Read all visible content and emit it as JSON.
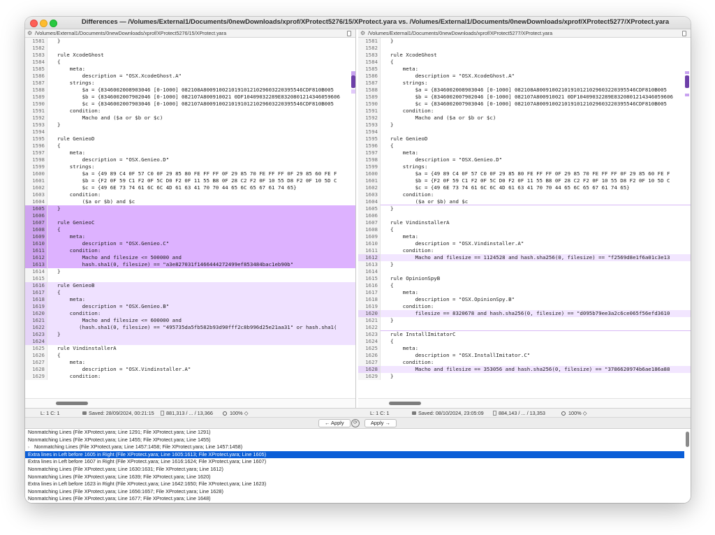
{
  "window": {
    "title": "Differences — /Volumes/External1/Documents/0newDownloads/xprof/XProtect5276/15/XProtect.yara vs. /Volumes/External1/Documents/0newDownloads/xprof/XProtect5277/XProtect.yara"
  },
  "left": {
    "path": "/Volumes/External1/Documents/0newDownloads/xprof/XProtect5276/15/XProtect.yara",
    "lines": [
      {
        "n": "1581",
        "t": "}",
        "h": ""
      },
      {
        "n": "1582",
        "t": "",
        "h": ""
      },
      {
        "n": "1583",
        "t": "rule XcodeGhost",
        "h": ""
      },
      {
        "n": "1584",
        "t": "{",
        "h": ""
      },
      {
        "n": "1585",
        "t": "    meta:",
        "h": ""
      },
      {
        "n": "1586",
        "t": "        description = \"OSX.XcodeGhost.A\"",
        "h": ""
      },
      {
        "n": "1587",
        "t": "    strings:",
        "h": ""
      },
      {
        "n": "1588",
        "t": "        $a = {8346002008903046 [0-1000] 082108A80091002101910121029603220395546CDF810B005",
        "h": ""
      },
      {
        "n": "1589",
        "t": "        $b = {8346002007902046 [0-1000] 082107A800910021 0DF10409032289E8320801214346059606",
        "h": ""
      },
      {
        "n": "1590",
        "t": "        $c = {8346002007903046 [0-1000] 082107A80091002101910121029603220395546CDF810B005",
        "h": ""
      },
      {
        "n": "1591",
        "t": "    condition:",
        "h": ""
      },
      {
        "n": "1592",
        "t": "        Macho and ($a or $b or $c)",
        "h": ""
      },
      {
        "n": "1593",
        "t": "}",
        "h": ""
      },
      {
        "n": "1594",
        "t": "",
        "h": ""
      },
      {
        "n": "1595",
        "t": "rule GenieoD",
        "h": ""
      },
      {
        "n": "1596",
        "t": "{",
        "h": ""
      },
      {
        "n": "1597",
        "t": "    meta:",
        "h": ""
      },
      {
        "n": "1598",
        "t": "        description = \"OSX.Genieo.D\"",
        "h": ""
      },
      {
        "n": "1599",
        "t": "    strings:",
        "h": ""
      },
      {
        "n": "1600",
        "t": "        $a = {49 89 C4 0F 57 C0 0F 29 85 80 FE FF FF 0F 29 85 70 FE FF FF 0F 29 85 60 FE F",
        "h": ""
      },
      {
        "n": "1601",
        "t": "        $b = {F2 0F 59 C1 F2 0F 5C D0 F2 0F 11 55 B8 0F 28 C2 F2 0F 10 55 D8 F2 0F 10 5D C",
        "h": ""
      },
      {
        "n": "1602",
        "t": "        $c = {49 6E 73 74 61 6C 6C 4D 61 63 41 70 70 44 65 6C 65 67 61 74 65}",
        "h": ""
      },
      {
        "n": "1603",
        "t": "    condition:",
        "h": ""
      },
      {
        "n": "1604",
        "t": "        ($a or $b) and $c",
        "h": ""
      },
      {
        "n": "1605",
        "t": "}",
        "h": "strong"
      },
      {
        "n": "1606",
        "t": "",
        "h": "strong"
      },
      {
        "n": "1607",
        "t": "rule GenieoC",
        "h": "strong"
      },
      {
        "n": "1608",
        "t": "{",
        "h": "strong"
      },
      {
        "n": "1609",
        "t": "    meta:",
        "h": "strong"
      },
      {
        "n": "1610",
        "t": "        description = \"OSX.Genieo.C\"",
        "h": "strong"
      },
      {
        "n": "1611",
        "t": "    condition:",
        "h": "strong"
      },
      {
        "n": "1612",
        "t": "        Macho and filesize <= 500000 and",
        "h": "strong"
      },
      {
        "n": "1613",
        "t": "        hash.sha1(0, filesize) == \"a3e827031f1466444272499ef853484bac1eb90b\"",
        "h": "strong"
      },
      {
        "n": "1614",
        "t": "}",
        "h": ""
      },
      {
        "n": "1615",
        "t": "",
        "h": ""
      },
      {
        "n": "1616",
        "t": "rule GenieoB",
        "h": "light"
      },
      {
        "n": "1617",
        "t": "{",
        "h": "light"
      },
      {
        "n": "1618",
        "t": "    meta:",
        "h": "light"
      },
      {
        "n": "1619",
        "t": "        description = \"OSX.Genieo.B\"",
        "h": "light"
      },
      {
        "n": "1620",
        "t": "    condition:",
        "h": "light"
      },
      {
        "n": "1621",
        "t": "        Macho and filesize <= 600000 and",
        "h": "light"
      },
      {
        "n": "1622",
        "t": "       (hash.sha1(0, filesize) == \"495735da5fb582b93d90fff2c8b996d25e21aa31\" or hash.sha1(",
        "h": "light"
      },
      {
        "n": "1623",
        "t": "}",
        "h": "light"
      },
      {
        "n": "1624",
        "t": "",
        "h": "light"
      },
      {
        "n": "1625",
        "t": "rule VindinstallerA",
        "h": ""
      },
      {
        "n": "1626",
        "t": "{",
        "h": ""
      },
      {
        "n": "1627",
        "t": "    meta:",
        "h": ""
      },
      {
        "n": "1628",
        "t": "        description = \"OSX.Vindinstaller.A\"",
        "h": ""
      },
      {
        "n": "1629",
        "t": "    condition:",
        "h": ""
      }
    ],
    "status": {
      "pos": "L: 1 C: 1",
      "saved": "Saved: 28/09/2024, 00:21:15",
      "count": "881,313 / ... / 13,366",
      "zoom": "100%"
    }
  },
  "right": {
    "path": "/Volumes/External1/Documents/0newDownloads/xprof/XProtect5277/XProtect.yara",
    "lines": [
      {
        "n": "1581",
        "t": "}",
        "h": ""
      },
      {
        "n": "1582",
        "t": "",
        "h": ""
      },
      {
        "n": "1583",
        "t": "rule XcodeGhost",
        "h": ""
      },
      {
        "n": "1584",
        "t": "{",
        "h": ""
      },
      {
        "n": "1585",
        "t": "    meta:",
        "h": ""
      },
      {
        "n": "1586",
        "t": "        description = \"OSX.XcodeGhost.A\"",
        "h": ""
      },
      {
        "n": "1587",
        "t": "    strings:",
        "h": ""
      },
      {
        "n": "1588",
        "t": "        $a = {8346002008903046 [0-1000] 082108A80091002101910121029603220395546CDF810B005",
        "h": ""
      },
      {
        "n": "1589",
        "t": "        $b = {8346002007902046 [0-1000] 082107A800910021 0DF10409032289E8320801214346059606",
        "h": ""
      },
      {
        "n": "1590",
        "t": "        $c = {8346002007903046 [0-1000] 082107A80091002101910121029603220395546CDF810B005",
        "h": ""
      },
      {
        "n": "1591",
        "t": "    condition:",
        "h": ""
      },
      {
        "n": "1592",
        "t": "        Macho and ($a or $b or $c)",
        "h": ""
      },
      {
        "n": "1593",
        "t": "}",
        "h": ""
      },
      {
        "n": "1594",
        "t": "",
        "h": ""
      },
      {
        "n": "1595",
        "t": "rule GenieoD",
        "h": ""
      },
      {
        "n": "1596",
        "t": "{",
        "h": ""
      },
      {
        "n": "1597",
        "t": "    meta:",
        "h": ""
      },
      {
        "n": "1598",
        "t": "        description = \"OSX.Genieo.D\"",
        "h": ""
      },
      {
        "n": "1599",
        "t": "    strings:",
        "h": ""
      },
      {
        "n": "1600",
        "t": "        $a = {49 89 C4 0F 57 C0 0F 29 85 80 FE FF FF 0F 29 85 70 FE FF FF 0F 29 85 60 FE F",
        "h": ""
      },
      {
        "n": "1601",
        "t": "        $b = {F2 0F 59 C1 F2 0F 5C D0 F2 0F 11 55 B8 0F 28 C2 F2 0F 10 55 D8 F2 0F 10 5D C",
        "h": ""
      },
      {
        "n": "1602",
        "t": "        $c = {49 6E 73 74 61 6C 6C 4D 61 63 41 70 70 44 65 6C 65 67 61 74 65}",
        "h": ""
      },
      {
        "n": "1603",
        "t": "    condition:",
        "h": ""
      },
      {
        "n": "1604",
        "t": "        ($a or $b) and $c",
        "h": "sep"
      },
      {
        "n": "1605",
        "t": "}",
        "h": ""
      },
      {
        "n": "1606",
        "t": "",
        "h": ""
      },
      {
        "n": "1607",
        "t": "rule VindinstallerA",
        "h": ""
      },
      {
        "n": "1608",
        "t": "{",
        "h": ""
      },
      {
        "n": "1609",
        "t": "    meta:",
        "h": ""
      },
      {
        "n": "1610",
        "t": "        description = \"OSX.Vindinstaller.A\"",
        "h": ""
      },
      {
        "n": "1611",
        "t": "    condition:",
        "h": ""
      },
      {
        "n": "1612",
        "t": "        Macho and filesize == 1124528 and hash.sha256(0, filesize) == \"f2569d8e1f6a01c3e13",
        "h": "line"
      },
      {
        "n": "1613",
        "t": "}",
        "h": ""
      },
      {
        "n": "1614",
        "t": "",
        "h": ""
      },
      {
        "n": "1615",
        "t": "rule OpinionSpyB",
        "h": ""
      },
      {
        "n": "1616",
        "t": "{",
        "h": ""
      },
      {
        "n": "1617",
        "t": "    meta:",
        "h": ""
      },
      {
        "n": "1618",
        "t": "        description = \"OSX.OpinionSpy.B\"",
        "h": ""
      },
      {
        "n": "1619",
        "t": "    condition:",
        "h": ""
      },
      {
        "n": "1620",
        "t": "        filesize == 8320678 and hash.sha256(0, filesize) == \"d095b79ee3a2c6ce065f56efd3610",
        "h": "line"
      },
      {
        "n": "1621",
        "t": "}",
        "h": ""
      },
      {
        "n": "1622",
        "t": "",
        "h": "sep"
      },
      {
        "n": "1623",
        "t": "rule InstallImitatorC",
        "h": ""
      },
      {
        "n": "1624",
        "t": "{",
        "h": ""
      },
      {
        "n": "1625",
        "t": "    meta:",
        "h": ""
      },
      {
        "n": "1626",
        "t": "        description = \"OSX.InstallImitator.C\"",
        "h": ""
      },
      {
        "n": "1627",
        "t": "    condition:",
        "h": ""
      },
      {
        "n": "1628",
        "t": "        Macho and filesize == 353056 and hash.sha256(0, filesize) == \"3786620974b6ae186a88",
        "h": "line"
      },
      {
        "n": "1629",
        "t": "}",
        "h": ""
      }
    ],
    "status": {
      "pos": "L: 1 C: 1",
      "saved": "Saved: 08/10/2024, 23:05:09",
      "count": "884,143 / ... / 13,353",
      "zoom": "100%"
    }
  },
  "apply": {
    "left_label": "← Apply",
    "right_label": "Apply →"
  },
  "differences": [
    {
      "text": "Nonmatching Lines (File XProtect.yara; Line 1291; File XProtect.yara; Line 1291)",
      "selected": false,
      "disclosure": false
    },
    {
      "text": "Nonmatching Lines (File XProtect.yara; Line 1455; File XProtect.yara; Line 1455)",
      "selected": false,
      "disclosure": false
    },
    {
      "text": "Nonmatching Lines (File XProtect.yara; Line 1457:1458; File XProtect.yara; Line 1457:1458)",
      "selected": false,
      "disclosure": true
    },
    {
      "text": "Extra lines in Left before 1605 in Right (File XProtect.yara; Line 1605:1613; File XProtect.yara; Line 1605)",
      "selected": true,
      "disclosure": false
    },
    {
      "text": "Extra lines in Left before 1607 in Right (File XProtect.yara; Line 1616:1624; File XProtect.yara; Line 1607)",
      "selected": false,
      "disclosure": false
    },
    {
      "text": "Nonmatching Lines (File XProtect.yara; Line 1630:1631; File XProtect.yara; Line 1612)",
      "selected": false,
      "disclosure": false
    },
    {
      "text": "Nonmatching Lines (File XProtect.yara; Line 1639; File XProtect.yara; Line 1620)",
      "selected": false,
      "disclosure": false
    },
    {
      "text": "Extra lines in Left before 1623 in Right (File XProtect.yara; Line 1642:1650; File XProtect.yara; Line 1623)",
      "selected": false,
      "disclosure": false
    },
    {
      "text": "Nonmatching Lines (File XProtect.yara; Line 1656:1657; File XProtect.yara; Line 1628)",
      "selected": false,
      "disclosure": false
    },
    {
      "text": "Nonmatching Lines (File XProtect.yara; Line 1677; File XProtect.yara; Line 1648)",
      "selected": false,
      "disclosure": false
    },
    {
      "text": "Nonmatching Lines (File XProtect.yara; Line 1679:1687; File XProtect.yara; Line 1650:1656)",
      "selected": false,
      "disclosure": false
    }
  ],
  "colors": {
    "strong_highlight": "#ddb2ff",
    "light_highlight": "#efe1ff",
    "selection": "#0b5ed7"
  }
}
